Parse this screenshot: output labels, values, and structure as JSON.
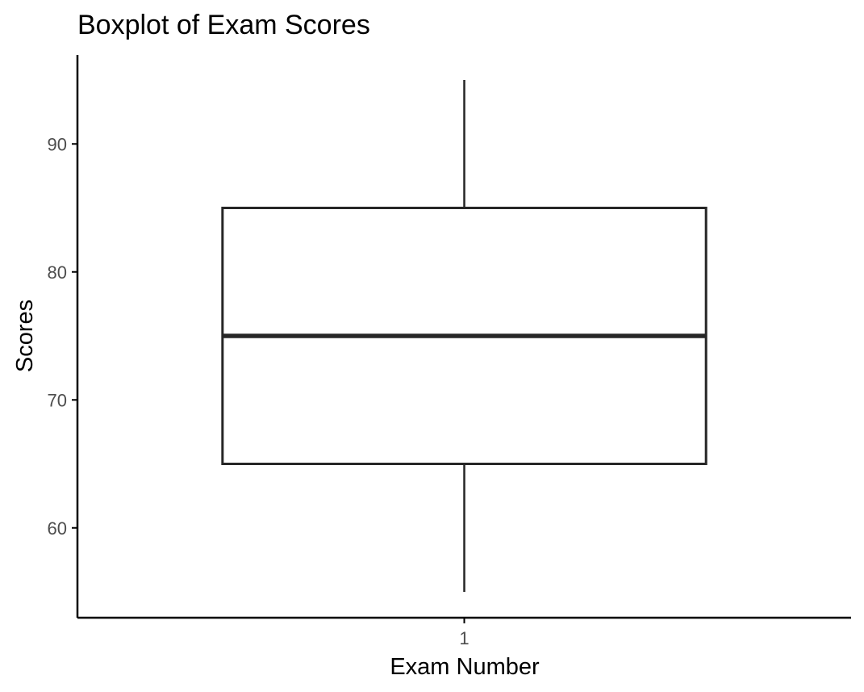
{
  "chart_data": {
    "type": "boxplot",
    "title": "Boxplot of Exam Scores",
    "xlabel": "Exam Number",
    "ylabel": "Scores",
    "categories": [
      "1"
    ],
    "boxes": [
      {
        "category": "1",
        "min": 55,
        "q1": 65,
        "median": 75,
        "q3": 85,
        "max": 95
      }
    ],
    "yticks": [
      60,
      70,
      80,
      90
    ],
    "ylim": [
      53,
      97
    ],
    "grid": false,
    "legend": "none",
    "colors": {
      "box_line": "#262626",
      "axis": "#000000",
      "tick_text": "#4d4d4d"
    }
  }
}
